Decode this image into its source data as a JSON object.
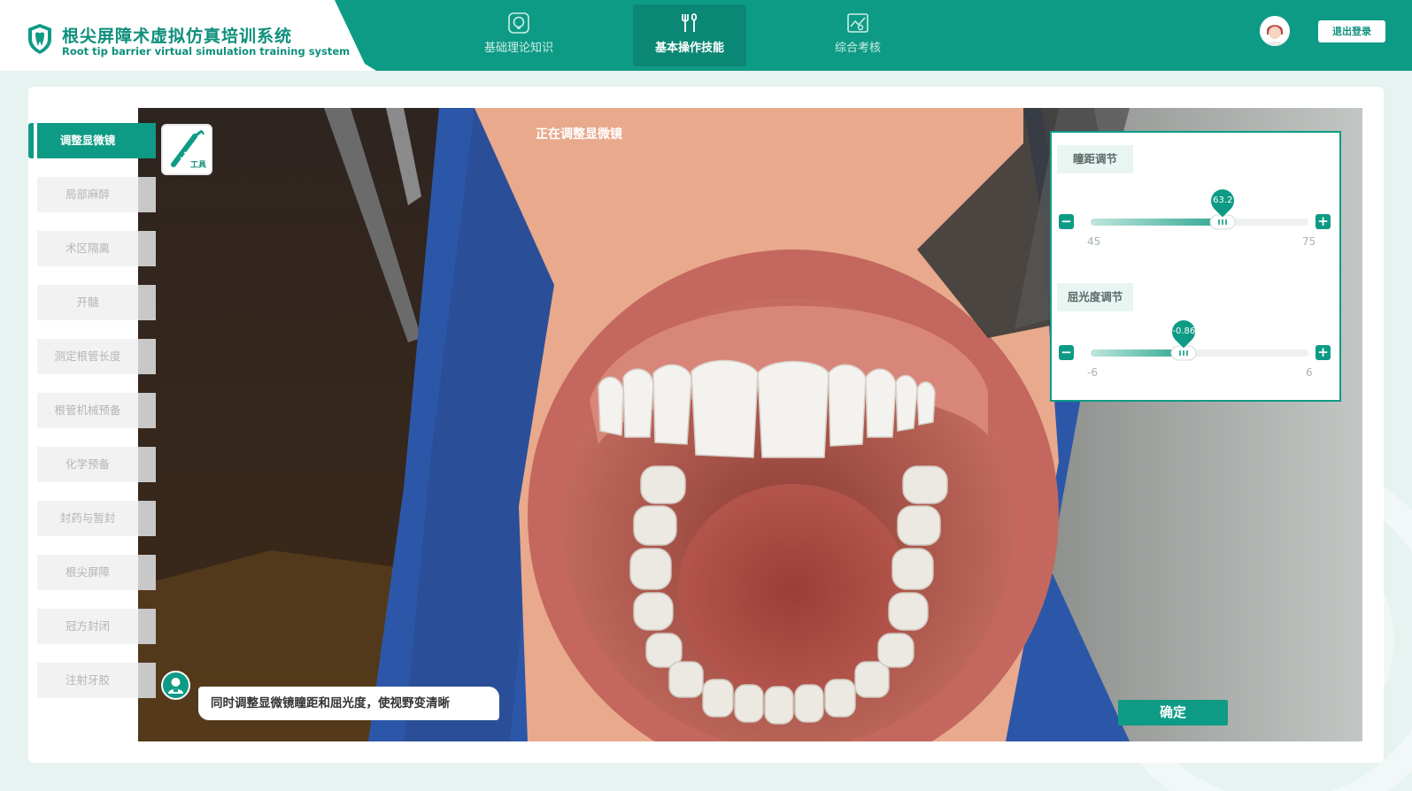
{
  "header": {
    "title": "根尖屏障术虚拟仿真培训系统",
    "subtitle": "Root tip barrier virtual simulation training system",
    "tabs": [
      {
        "label": "基础理论知识",
        "icon": "knowledge-icon",
        "active": false
      },
      {
        "label": "基本操作技能",
        "icon": "tools-icon",
        "active": true
      },
      {
        "label": "综合考核",
        "icon": "assessment-icon",
        "active": false
      }
    ],
    "logout_label": "退出登录"
  },
  "steps": [
    {
      "label": "调整显微镜",
      "active": true
    },
    {
      "label": "局部麻醉",
      "active": false
    },
    {
      "label": "术区隔离",
      "active": false
    },
    {
      "label": "开髓",
      "active": false
    },
    {
      "label": "测定根管长度",
      "active": false
    },
    {
      "label": "根管机械预备",
      "active": false
    },
    {
      "label": "化学预备",
      "active": false
    },
    {
      "label": "封药与暂封",
      "active": false
    },
    {
      "label": "根尖屏障",
      "active": false
    },
    {
      "label": "冠方封闭",
      "active": false
    },
    {
      "label": "注射牙胶",
      "active": false
    }
  ],
  "tool": {
    "label": "工具",
    "icon": "handpiece-icon"
  },
  "status_text": "正在调整显微镜",
  "controls": {
    "pupil": {
      "label": "瞳距调节",
      "value": "63.2",
      "min": "45",
      "max": "75",
      "fraction": 0.607
    },
    "diopter": {
      "label": "屈光度调节",
      "value": "-0.86",
      "min": "-6",
      "max": "6",
      "fraction": 0.428
    }
  },
  "confirm_label": "确定",
  "hint_text": "同时调整显微镜瞳距和屈光度，使视野变清晰",
  "colors": {
    "accent": "#0e9b86",
    "accent_dark": "#0b8775",
    "drape": "#2c57a8"
  }
}
